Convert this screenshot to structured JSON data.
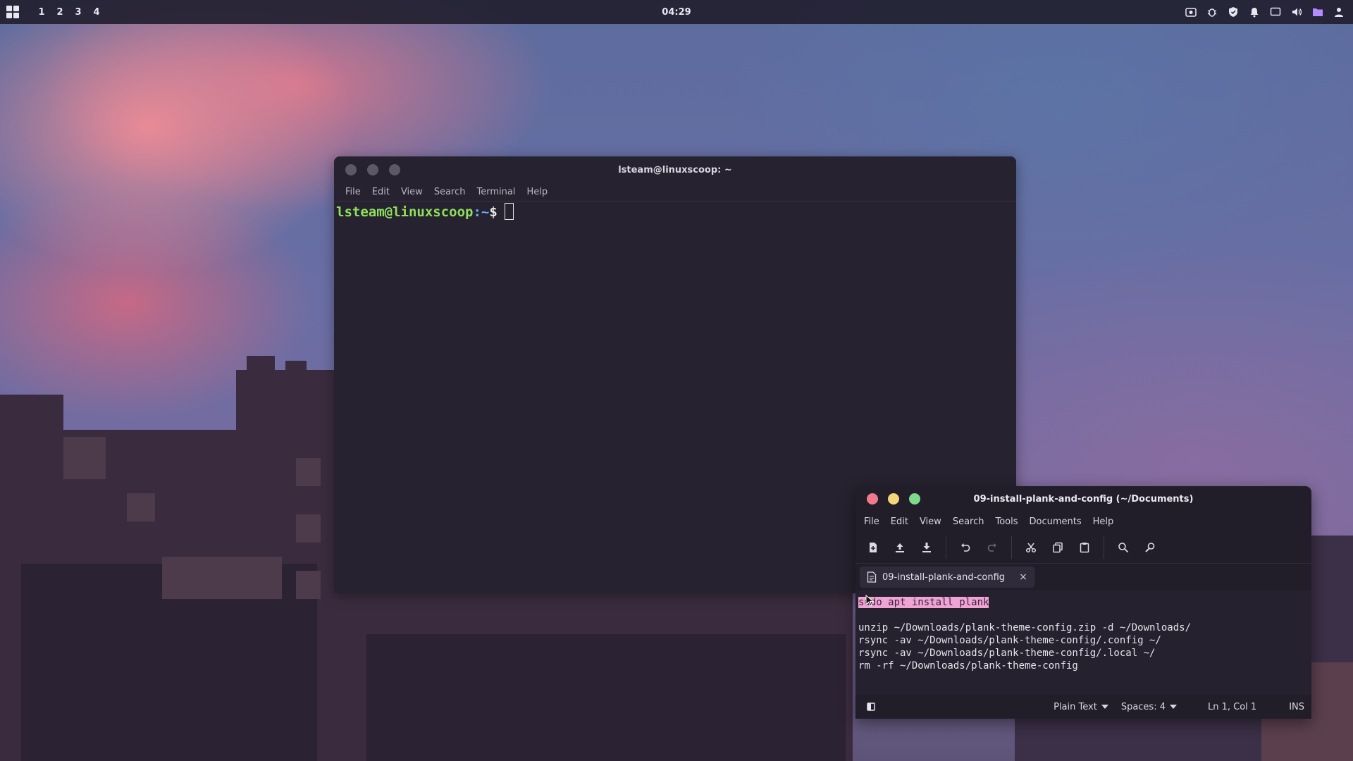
{
  "panel": {
    "workspaces": [
      "1",
      "2",
      "3",
      "4"
    ],
    "clock": "04:29",
    "tray_icons": [
      "screenshot-icon",
      "bug-icon",
      "shield-icon",
      "bell-icon",
      "display-icon",
      "volume-icon",
      "folder-icon",
      "user-icon"
    ],
    "accent": "#b48cff"
  },
  "terminal": {
    "title": "lsteam@linuxscoop: ~",
    "menu": [
      "File",
      "Edit",
      "View",
      "Search",
      "Terminal",
      "Help"
    ],
    "prompt_user": "lsteam@linuxscoop",
    "prompt_path": ":~",
    "prompt_sign": "$",
    "colors": {
      "user": "#8fe05a",
      "path": "#6fa8ff",
      "background": "#26222f"
    }
  },
  "editor": {
    "title": "09-install-plank-and-config (~/Documents)",
    "menu": [
      "File",
      "Edit",
      "View",
      "Search",
      "Tools",
      "Documents",
      "Help"
    ],
    "toolbar": [
      "new-document-icon",
      "open-icon",
      "save-icon",
      "undo-icon",
      "redo-icon",
      "cut-icon",
      "copy-icon",
      "paste-icon",
      "find-icon",
      "replace-icon"
    ],
    "tab": {
      "label": "09-install-plank-and-config",
      "close": "×"
    },
    "lines": [
      "sudo apt install plank",
      "",
      "unzip ~/Downloads/plank-theme-config.zip -d ~/Downloads/",
      "rsync -av ~/Downloads/plank-theme-config/.config ~/",
      "rsync -av ~/Downloads/plank-theme-config/.local ~/",
      "rm -rf ~/Downloads/plank-theme-config"
    ],
    "status": {
      "language": "Plain Text",
      "spaces": "Spaces: 4",
      "position": "Ln 1, Col 1",
      "mode": "INS"
    },
    "colors": {
      "close": "#f07a8a",
      "minimize": "#f4d67a",
      "maximize": "#7fd98a",
      "selection": "#f0a4d6"
    }
  }
}
